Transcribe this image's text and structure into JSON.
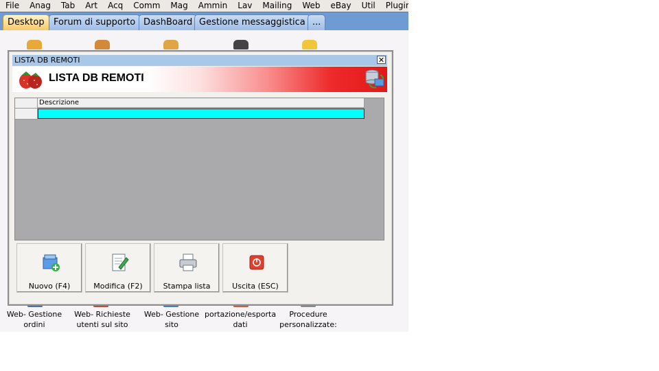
{
  "menubar": {
    "items": [
      "File",
      "Anag",
      "Tab",
      "Art",
      "Acq",
      "Comm",
      "Mag",
      "Ammin",
      "Lav",
      "Mailing",
      "Web",
      "eBay",
      "Util",
      "Plugin"
    ]
  },
  "tabs": [
    {
      "label": "Desktop",
      "active": true
    },
    {
      "label": "Forum di supporto",
      "active": false
    },
    {
      "label": "DashBoard",
      "active": false
    },
    {
      "label": "Gestione messaggistica",
      "active": false
    },
    {
      "label": "...",
      "active": false
    }
  ],
  "desktop_labels": [
    "Web- Gestione\nordini",
    "Web- Richieste\nutenti sul sito",
    "Web- Gestione sito",
    "portazione/esportazio\ndati",
    "Procedure\npersonalizzate:"
  ],
  "dialog": {
    "window_title": "LISTA DB REMOTI",
    "banner_title": "LISTA DB REMOTI",
    "grid": {
      "columns": [
        "Descrizione"
      ],
      "rows": [
        [
          ""
        ]
      ]
    },
    "buttons": [
      {
        "label": "Nuovo (F4)",
        "icon": "new-database-icon"
      },
      {
        "label": "Modifica (F2)",
        "icon": "edit-document-icon"
      },
      {
        "label": "Stampa lista",
        "icon": "printer-icon"
      },
      {
        "label": "Uscita (ESC)",
        "icon": "power-icon"
      }
    ]
  },
  "colors": {
    "tabbar": "#6f9bd4",
    "active_tab": "#f7c86a",
    "banner_red": "#e21818",
    "grid_selection": "#00ffff",
    "grid_background": "#aaa9ab"
  }
}
